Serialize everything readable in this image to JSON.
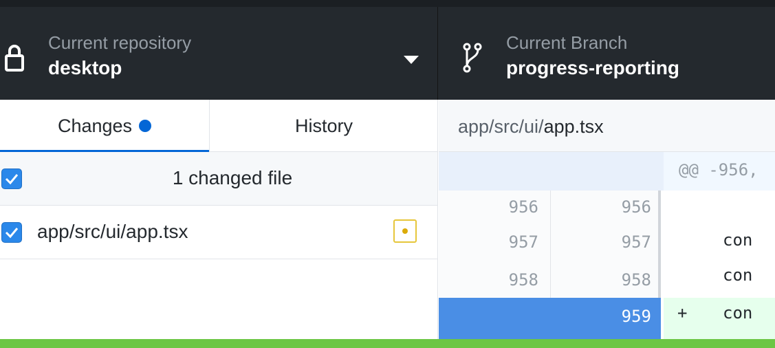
{
  "toolbar": {
    "repository": {
      "label": "Current repository",
      "value": "desktop",
      "icon": "lock-icon"
    },
    "branch": {
      "label": "Current Branch",
      "value": "progress-reporting",
      "icon": "git-branch-icon"
    }
  },
  "tabs": {
    "changes": "Changes",
    "history": "History",
    "active": "changes"
  },
  "changes": {
    "summary": "1 changed file",
    "files": [
      {
        "path": "app/src/ui/app.tsx",
        "checked": true,
        "status": "modified"
      }
    ]
  },
  "diff": {
    "path_prefix": "app/src/ui/",
    "path_file": "app.tsx",
    "hunk": "@@ -956,",
    "lines": [
      {
        "old": "956",
        "new": "956",
        "sign": "",
        "code": ""
      },
      {
        "old": "957",
        "new": "957",
        "sign": "",
        "code": "con"
      },
      {
        "old": "958",
        "new": "958",
        "sign": "",
        "code": "con"
      },
      {
        "old": "",
        "new": "959",
        "sign": "+",
        "code": "con"
      }
    ]
  },
  "colors": {
    "accent": "#0366d6",
    "toolbar_bg": "#24292e",
    "selection": "#4a8ee5",
    "added_bg": "#e6ffed",
    "bottom_bar": "#6cc644"
  }
}
